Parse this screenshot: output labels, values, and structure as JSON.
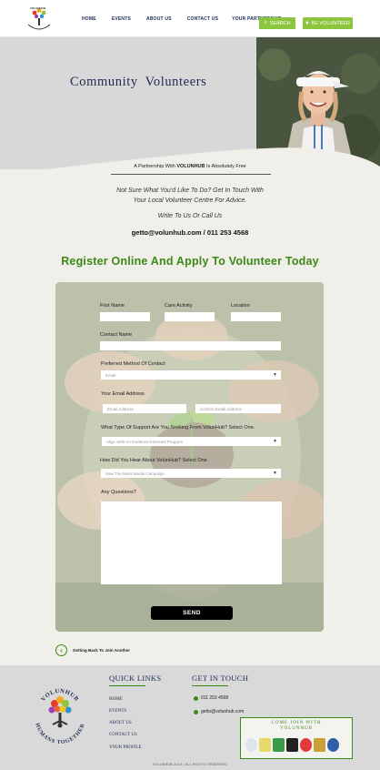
{
  "header": {
    "logo_text": "VOLUNHUB",
    "nav": [
      "HOME",
      "EVENTS",
      "ABOUT US",
      "CONTACT US",
      "YOUR PARTNERSHIP"
    ],
    "search_label": "SEARCH",
    "volunteer_label": "BE VOLUNTEER"
  },
  "hero": {
    "title": "Community Volunteers"
  },
  "intro": {
    "partner_prefix": "A Partnership With ",
    "partner_brand": "VOLUNHUB",
    "partner_suffix": " Is Absolutely Free",
    "advice_line1": "Not Sure What You'd Like To Do? Get In Touch With",
    "advice_line2": "Your Local Volunteer Centre For Advice.",
    "write": "Write To Us Or Call Us",
    "contact": "getto@volunhub.com / 011 253 4568"
  },
  "register_title": "Register Online And Apply To Volunteer Today",
  "form": {
    "first_name_label": "First Name",
    "care_activity_label": "Care Activity",
    "location_label": "Location",
    "contact_name_label": "Contact Name",
    "preferred_method_label": "Preferred Method Of Contact",
    "preferred_method_value": "Email",
    "email_label": "Your Email Address",
    "email_placeholder": "Email Address",
    "confirm_email_placeholder": "Confirm Email Address",
    "support_label": "What Type Of Support Are You Seeking From VolunHub? Select One.",
    "support_value": "Align With An Evidence-Informed Program",
    "heard_label": "How Did You Hear About VolunHub? Select One.",
    "heard_value": "Saw The Mass Media Campaign",
    "questions_label": "Any Questions?",
    "send_label": "SEND"
  },
  "back_link": "Getting Back To Join Another",
  "footer": {
    "logo_top": "VOLUNHUB",
    "logo_bottom": "HUMANS TOGETHER",
    "quick_links_title": "QUICK LINKS",
    "quick_links": [
      "HOME",
      "EVENTS",
      "ABOUT US",
      "CONTACT US",
      "YOUR PROFILE"
    ],
    "get_in_touch_title": "GET IN TOUCH",
    "phone": "011 253 4568",
    "email": "getto@volunhub.com",
    "join_title_1": "COME JOIN WITH",
    "join_title_2": "VOLUNHUB",
    "copyright": "VOLUNHUB 2019 | ALL RIGHTS RESERVED"
  },
  "colors": {
    "accent": "#3b8a16",
    "button_green": "#8cc63f",
    "navy": "#1b2a52"
  }
}
